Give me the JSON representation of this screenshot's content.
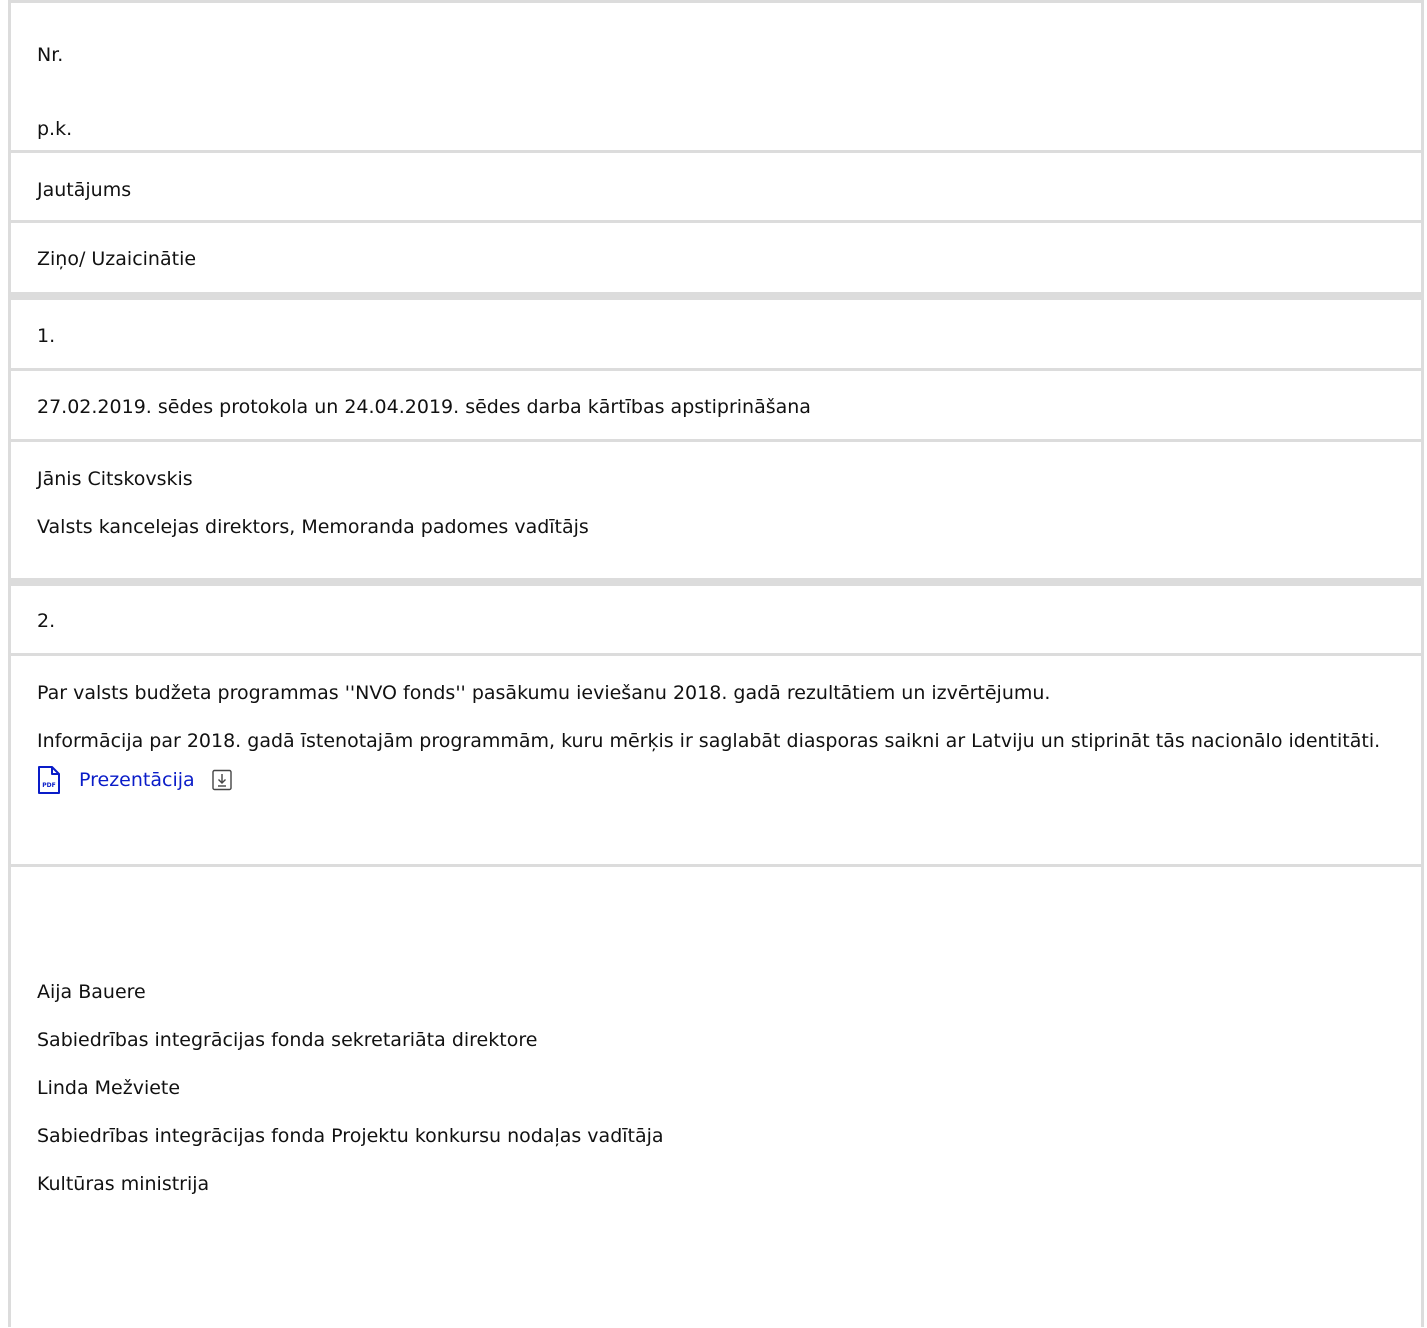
{
  "header": {
    "nr_line1": "Nr.",
    "nr_line2": "p.k.",
    "question": "Jautājums",
    "speakers": "Ziņo/ Uzaicinātie"
  },
  "items": [
    {
      "number": "1.",
      "question": "27.02.2019. sēdes protokola un 24.04.2019. sēdes darba kārtības apstiprināšana",
      "speakers": [
        "Jānis Citskovskis",
        "Valsts kancelejas direktors, Memoranda padomes vadītājs"
      ]
    },
    {
      "number": "2.",
      "question_lines": [
        "Par valsts budžeta programmas ''NVO fonds'' pasākumu ieviešanu 2018. gadā rezultātiem un izvērtējumu.",
        "Informācija par 2018. gadā īstenotajām programmām, kuru mērķis ir saglabāt diasporas saikni ar Latviju un stiprināt tās nacionālo identitāti."
      ],
      "attachment": {
        "label": "Prezentācija",
        "icon": "pdf-file-icon",
        "download_icon": "download-icon"
      },
      "speakers": [
        "Aija Bauere",
        "Sabiedrības integrācijas fonda sekretariāta direktore",
        "Linda Mežviete",
        "Sabiedrības integrācijas fonda Projektu konkursu nodaļas vadītāja",
        "Kultūras ministrija"
      ]
    }
  ],
  "colors": {
    "border": "#dcdcdc",
    "link": "#0a1cc8",
    "text": "#111111"
  }
}
